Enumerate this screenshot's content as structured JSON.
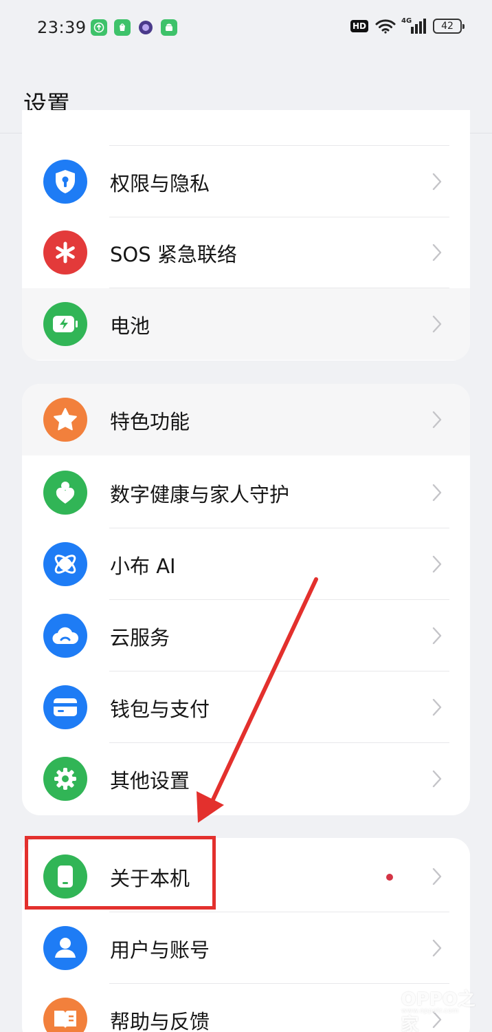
{
  "status_bar": {
    "time": "23:39",
    "hd_label": "HD",
    "network_label": "4G",
    "battery_level": "42",
    "notification_icons": [
      "download-arrow-icon",
      "app-store-icon",
      "browser-orb-icon",
      "android-icon"
    ]
  },
  "header": {
    "title": "设置"
  },
  "sections": [
    {
      "items": [
        {
          "label": "权限与隐私",
          "icon": "shield-lock-icon",
          "color": "#1e7cf5"
        },
        {
          "label": "SOS 紧急联络",
          "icon": "asterisk-icon",
          "color": "#e33a3a"
        },
        {
          "label": "电池",
          "icon": "battery-icon",
          "color": "#31b556"
        }
      ]
    },
    {
      "items": [
        {
          "label": "特色功能",
          "icon": "star-icon",
          "color": "#f2803c"
        },
        {
          "label": "数字健康与家人守护",
          "icon": "family-heart-icon",
          "color": "#31b556"
        },
        {
          "label": "小布 AI",
          "icon": "ai-orbit-icon",
          "color": "#1e7cf5"
        },
        {
          "label": "云服务",
          "icon": "cloud-icon",
          "color": "#1e7cf5"
        },
        {
          "label": "钱包与支付",
          "icon": "wallet-card-icon",
          "color": "#1e7cf5"
        },
        {
          "label": "其他设置",
          "icon": "gear-icon",
          "color": "#31b556"
        }
      ]
    },
    {
      "items": [
        {
          "label": "关于本机",
          "icon": "phone-icon",
          "color": "#31b556",
          "has_badge": true
        },
        {
          "label": "用户与账号",
          "icon": "user-icon",
          "color": "#1e7cf5"
        },
        {
          "label": "帮助与反馈",
          "icon": "book-icon",
          "color": "#f2803c"
        }
      ]
    }
  ],
  "watermark": {
    "text": "OPPO之家",
    "sub": "www.oppotr.com"
  },
  "colors": {
    "annotation": "#e3302d",
    "badge": "#d43445"
  }
}
